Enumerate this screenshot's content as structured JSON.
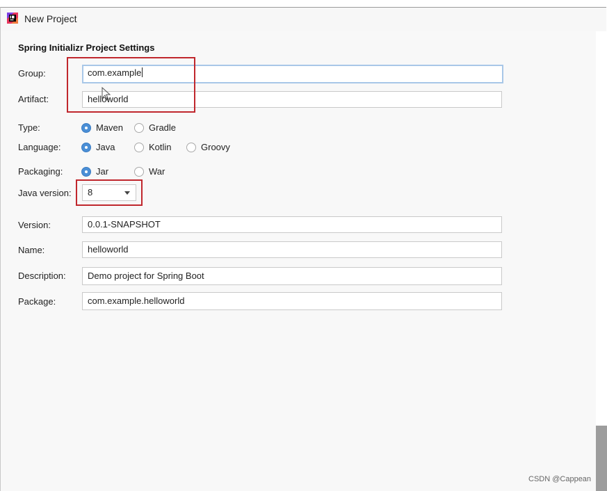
{
  "window": {
    "title": "New Project",
    "icon": "intellij-app-icon"
  },
  "section": {
    "title": "Spring Initializr Project Settings"
  },
  "labels": {
    "group": "Group:",
    "artifact": "Artifact:",
    "type": "Type:",
    "language": "Language:",
    "packaging": "Packaging:",
    "java_version": "Java version:",
    "version": "Version:",
    "name": "Name:",
    "description": "Description:",
    "package": "Package:"
  },
  "fields": {
    "group": "com.example",
    "artifact": "helloworld",
    "version": "0.0.1-SNAPSHOT",
    "name": "helloworld",
    "description": "Demo project for Spring Boot",
    "package": "com.example.helloworld"
  },
  "type_options": [
    {
      "label": "Maven",
      "selected": true
    },
    {
      "label": "Gradle",
      "selected": false
    }
  ],
  "language_options": [
    {
      "label": "Java",
      "selected": true
    },
    {
      "label": "Kotlin",
      "selected": false
    },
    {
      "label": "Groovy",
      "selected": false
    }
  ],
  "packaging_options": [
    {
      "label": "Jar",
      "selected": true
    },
    {
      "label": "War",
      "selected": false
    }
  ],
  "java_version": {
    "selected": "8"
  },
  "watermark": "CSDN @Cappean",
  "colors": {
    "highlight": "#c0272d",
    "radio_selected": "#4b8fd6",
    "focus_border": "#a8c7e8"
  }
}
